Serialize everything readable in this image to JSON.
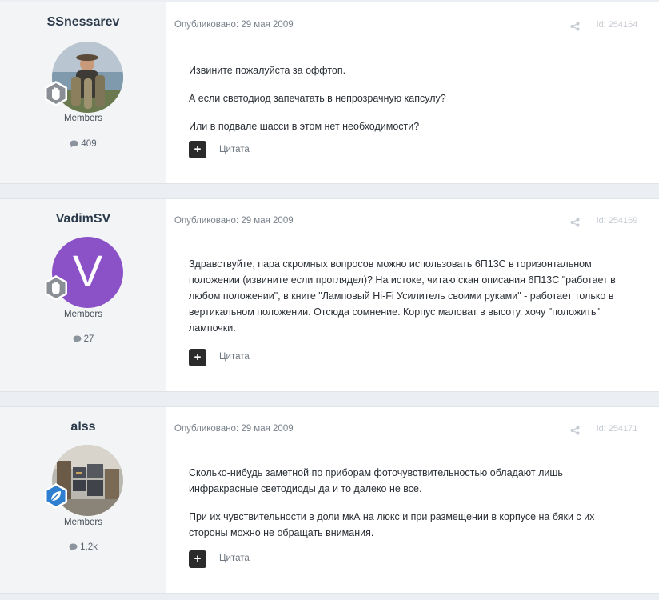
{
  "posts": [
    {
      "author": "SSnessarev",
      "group": "Members",
      "post_count": "409",
      "published": "Опубликовано: 29 мая 2009",
      "post_id": "id: 254164",
      "paragraphs": [
        "Извините пожалуйста за оффтоп.",
        "А если светодиод запечатать в непрозрачную капсулу?",
        "Или в подвале шасси в этом нет необходимости?"
      ],
      "avatar_type": "photo-fisherman",
      "badge_icon": "hand-icon",
      "badge_color": "#8a8f95",
      "quote_label": "Цитата",
      "plus_label": "+"
    },
    {
      "author": "VadimSV",
      "group": "Members",
      "post_count": "27",
      "published": "Опубликовано: 29 мая 2009",
      "post_id": "id: 254169",
      "paragraphs": [
        "Здравствуйте, пара скромных вопросов можно использовать 6П13С в горизонтальном положении (извините если проглядел)? На истоке, читаю скан описания 6П13С \"работает в любом положении\", в книге \"Ламповый Hi-Fi Усилитель своими руками\" - работает только в вертикальном положении. Отсюда сомнение. Корпус маловат в высоту, хочу \"положить\" лампочки."
      ],
      "avatar_type": "letter",
      "avatar_letter": "V",
      "avatar_color": "#8b52c8",
      "badge_icon": "hand-icon",
      "badge_color": "#8a8f95",
      "quote_label": "Цитата",
      "plus_label": "+"
    },
    {
      "author": "alss",
      "group": "Members",
      "post_count": "1,2k",
      "published": "Опубликовано: 29 мая 2009",
      "post_id": "id: 254171",
      "paragraphs": [
        "Сколько-нибудь заметной по приборам фоточувствительностью обладают лишь инфракрасные светодиоды да и то далеко не все.",
        "При их чувствительности в доли мкА на люкс и при размещении в корпусе на бяки с их стороны можно не обращать внимания."
      ],
      "avatar_type": "photo-equipment",
      "badge_icon": "leaf-icon",
      "badge_color": "#2f7fd0",
      "quote_label": "Цитата",
      "plus_label": "+"
    }
  ]
}
